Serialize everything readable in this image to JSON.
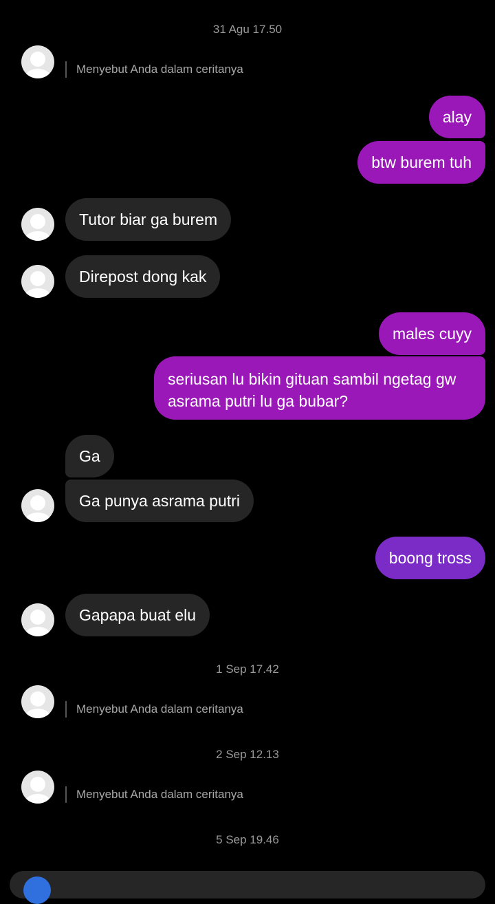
{
  "timestamps": [
    "31 Agu 17.50",
    "1 Sep 17.42",
    "2 Sep 12.13",
    "5 Sep 19.46"
  ],
  "mention_text": "Menyebut Anda dalam ceritanya",
  "messages": [
    {
      "from": "them",
      "text": "Menyebut Anda dalam ceritanya",
      "kind": "mention"
    },
    {
      "from": "me",
      "text": "alay"
    },
    {
      "from": "me",
      "text": "btw burem tuh"
    },
    {
      "from": "them",
      "text": "Tutor biar ga burem"
    },
    {
      "from": "them",
      "text": "Direpost dong kak"
    },
    {
      "from": "me",
      "text": "males cuyy"
    },
    {
      "from": "me",
      "text": "seriusan lu bikin gituan sambil ngetag gw asrama putri lu ga bubar?"
    },
    {
      "from": "them",
      "text": "Ga"
    },
    {
      "from": "them",
      "text": "Ga punya asrama putri"
    },
    {
      "from": "me",
      "text": "boong tross"
    },
    {
      "from": "them",
      "text": "Gapapa buat elu"
    }
  ],
  "colors": {
    "outgoing": "#9b18b8",
    "outgoing_alt": "#7c2cc6",
    "incoming": "#262626",
    "background": "#000000"
  }
}
